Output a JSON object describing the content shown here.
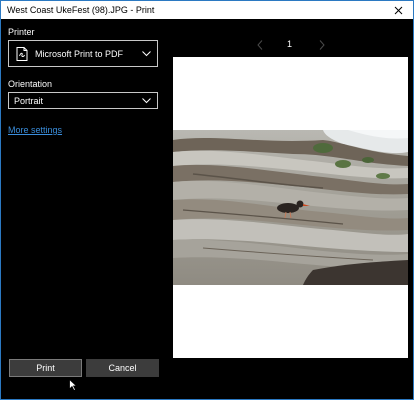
{
  "window": {
    "title": "West Coast UkeFest (98).JPG - Print",
    "close_icon": "close-icon"
  },
  "printer": {
    "label": "Printer",
    "selected": "Microsoft Print to PDF",
    "icon": "pdf-printer-icon"
  },
  "orientation": {
    "label": "Orientation",
    "selected": "Portrait"
  },
  "more_settings": "More settings",
  "preview": {
    "page_number": "1"
  },
  "buttons": {
    "print": "Print",
    "cancel": "Cancel"
  },
  "colors": {
    "accent": "#2b79c2",
    "link": "#3a8ddb",
    "button_bg": "#3c3c3c"
  }
}
